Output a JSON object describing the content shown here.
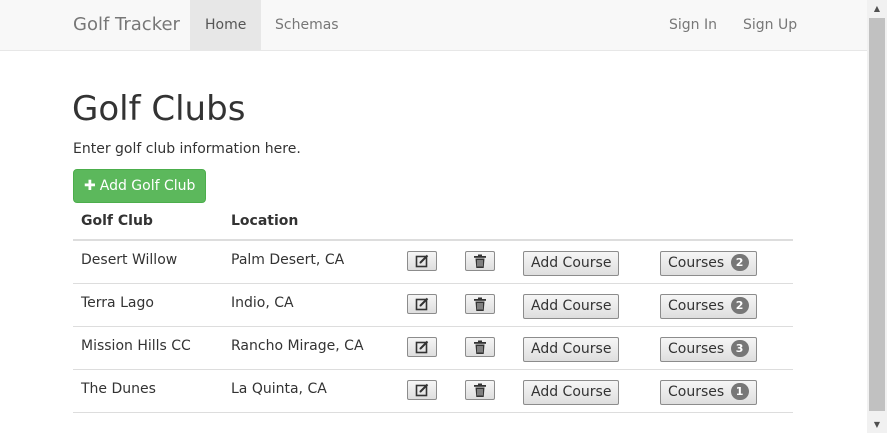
{
  "navbar": {
    "brand": "Golf Tracker",
    "links": [
      "Home",
      "Schemas"
    ],
    "right_links": [
      "Sign In",
      "Sign Up"
    ]
  },
  "page": {
    "title": "Golf Clubs",
    "subtitle": "Enter golf club information here.",
    "add_button": "Add Golf Club"
  },
  "table": {
    "headers": [
      "Golf Club",
      "Location"
    ],
    "add_course_label": "Add Course",
    "courses_label": "Courses",
    "rows": [
      {
        "club": "Desert Willow",
        "location": "Palm Desert, CA",
        "courses": "2"
      },
      {
        "club": "Terra Lago",
        "location": "Indio, CA",
        "courses": "2"
      },
      {
        "club": "Mission Hills CC",
        "location": "Rancho Mirage, CA",
        "courses": "3"
      },
      {
        "club": "The Dunes",
        "location": "La Quinta, CA",
        "courses": "1"
      }
    ]
  },
  "icons": {
    "edit": "edit-icon",
    "delete": "trash-icon",
    "add": "plus-icon"
  },
  "colors": {
    "success": "#5cb85c",
    "badge": "#777777",
    "navbar": "#f8f8f8"
  }
}
